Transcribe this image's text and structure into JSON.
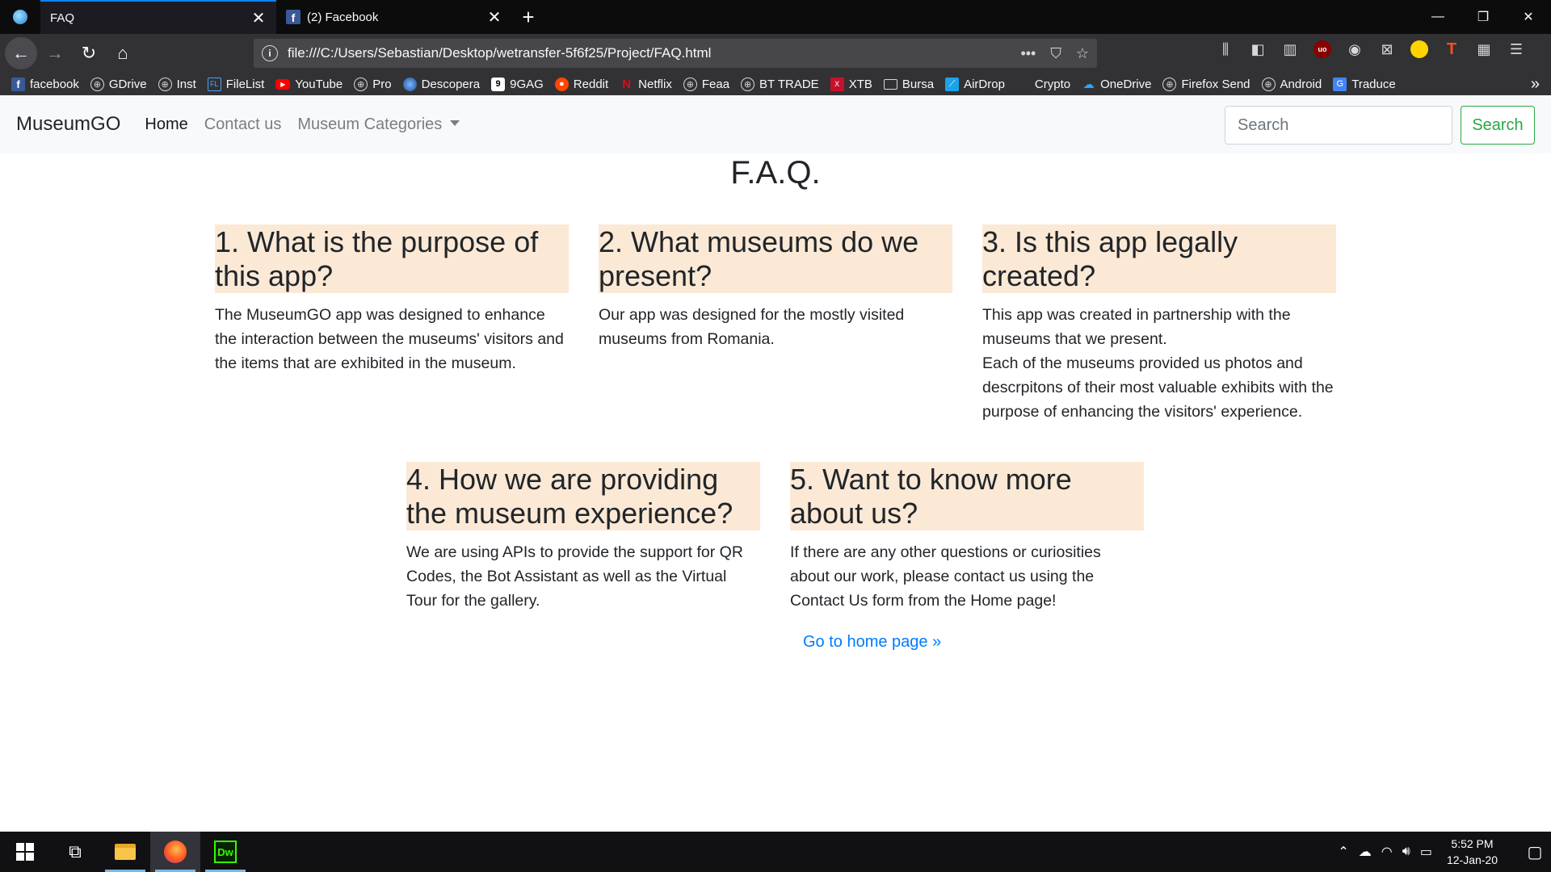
{
  "browser": {
    "tabs": [
      {
        "title": "FAQ"
      },
      {
        "title": "(2) Facebook"
      }
    ],
    "url": "file:///C:/Users/Sebastian/Desktop/wetransfer-5f6f25/Project/FAQ.html",
    "bookmarks": [
      "facebook",
      "GDrive",
      "Inst",
      "FileList",
      "YouTube",
      "Pro",
      "Descopera",
      "9GAG",
      "Reddit",
      "Netflix",
      "Feaa",
      "BT TRADE",
      "XTB",
      "Bursa",
      "AirDrop",
      "Crypto",
      "OneDrive",
      "Firefox Send",
      "Android",
      "Traduce"
    ]
  },
  "site": {
    "brand": "MuseumGO",
    "nav": {
      "home": "Home",
      "contact": "Contact us",
      "categories": "Museum Categories"
    },
    "search": {
      "placeholder": "Search",
      "button": "Search"
    },
    "page_title": "F.A.Q.",
    "faqs": [
      {
        "question": "1. What is the purpose of this app?",
        "answer": "The MuseumGO app was designed to enhance the interaction between the museums' visitors and the items that are exhibited in the museum."
      },
      {
        "question": "2. What museums do we present?",
        "answer": "Our app was designed for the mostly visited museums from Romania."
      },
      {
        "question": "3. Is this app legally created?",
        "answer": "This app was created in partnership with the museums that we present.",
        "answer2": "Each of the museums provided us photos and descrpitons of their most valuable exhibits with the purpose of enhancing the visitors' experience."
      },
      {
        "question": "4. How we are providing the museum experience?",
        "answer": "We are using APIs to provide the support for QR Codes, the Bot Assistant as well as the Virtual Tour for the gallery."
      },
      {
        "question": "5. Want to know more about us?",
        "answer": "If there are any other questions or curiosities about our work, please contact us using the Contact Us form from the Home page!"
      }
    ],
    "home_link": "Go to home page »"
  },
  "taskbar": {
    "time": "5:52 PM",
    "date": "12-Jan-20"
  }
}
